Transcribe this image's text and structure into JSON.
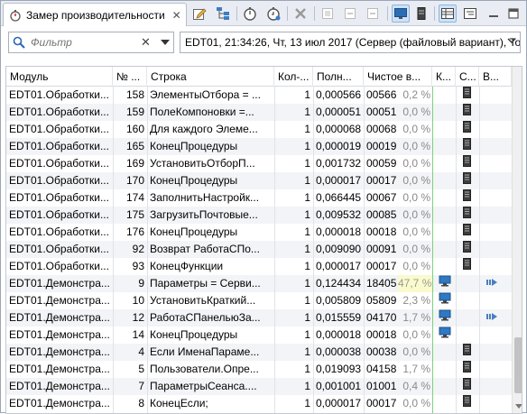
{
  "tab": {
    "title": "Замер производительности",
    "close": "✕"
  },
  "filter": {
    "placeholder": "Фильтр",
    "clear": "✕"
  },
  "session": {
    "text": "EDT01, 21:34:26, Чт, 13 июл 2017 (Сервер (файловый вариант), To"
  },
  "columns": [
    "Модуль",
    "№ ...",
    "Строка",
    "Кол-...",
    "Полн...",
    "Чистое в...",
    "К...",
    "С...",
    "В..."
  ],
  "rows": [
    {
      "module": "EDT01.Обработки...",
      "num": "158",
      "line": "ЭлементыОтбора = ...",
      "count": "1",
      "full": "0,000566",
      "net": "00566",
      "pct": "0,2 %",
      "client": false,
      "server": true,
      "call": false,
      "hl": false
    },
    {
      "module": "EDT01.Обработки...",
      "num": "159",
      "line": "ПолеКомпоновки =...",
      "count": "1",
      "full": "0,000051",
      "net": "00051",
      "pct": "0,0 %",
      "client": false,
      "server": true,
      "call": false,
      "hl": false
    },
    {
      "module": "EDT01.Обработки...",
      "num": "160",
      "line": "Для каждого Элеме...",
      "count": "1",
      "full": "0,000068",
      "net": "00068",
      "pct": "0,0 %",
      "client": false,
      "server": true,
      "call": false,
      "hl": false
    },
    {
      "module": "EDT01.Обработки...",
      "num": "165",
      "line": "КонецПроцедуры",
      "count": "1",
      "full": "0,000019",
      "net": "00019",
      "pct": "0,0 %",
      "client": false,
      "server": true,
      "call": false,
      "hl": false
    },
    {
      "module": "EDT01.Обработки...",
      "num": "169",
      "line": "УстановитьОтборП...",
      "count": "1",
      "full": "0,001732",
      "net": "00059",
      "pct": "0,0 %",
      "client": false,
      "server": true,
      "call": false,
      "hl": false
    },
    {
      "module": "EDT01.Обработки...",
      "num": "170",
      "line": "КонецПроцедуры",
      "count": "1",
      "full": "0,000017",
      "net": "00017",
      "pct": "0,0 %",
      "client": false,
      "server": true,
      "call": false,
      "hl": false
    },
    {
      "module": "EDT01.Обработки...",
      "num": "174",
      "line": "ЗаполнитьНастройк...",
      "count": "1",
      "full": "0,066445",
      "net": "00067",
      "pct": "0,0 %",
      "client": false,
      "server": true,
      "call": false,
      "hl": false
    },
    {
      "module": "EDT01.Обработки...",
      "num": "175",
      "line": "ЗагрузитьПочтовые...",
      "count": "1",
      "full": "0,009532",
      "net": "00085",
      "pct": "0,0 %",
      "client": false,
      "server": true,
      "call": false,
      "hl": false
    },
    {
      "module": "EDT01.Обработки...",
      "num": "176",
      "line": "КонецПроцедуры",
      "count": "1",
      "full": "0,000018",
      "net": "00018",
      "pct": "0,0 %",
      "client": false,
      "server": true,
      "call": false,
      "hl": false
    },
    {
      "module": "EDT01.Обработки...",
      "num": "92",
      "line": "Возврат РаботаСПо...",
      "count": "1",
      "full": "0,009090",
      "net": "00091",
      "pct": "0,0 %",
      "client": false,
      "server": true,
      "call": false,
      "hl": false
    },
    {
      "module": "EDT01.Обработки...",
      "num": "93",
      "line": "КонецФункции",
      "count": "1",
      "full": "0,000017",
      "net": "00017",
      "pct": "0,0 %",
      "client": false,
      "server": true,
      "call": false,
      "hl": false
    },
    {
      "module": "EDT01.Демонстра...",
      "num": "9",
      "line": "Параметры = Серви...",
      "count": "1",
      "full": "0,124434",
      "net": "18405",
      "pct": "47,7 %",
      "client": true,
      "server": false,
      "call": true,
      "hl": true
    },
    {
      "module": "EDT01.Демонстра...",
      "num": "10",
      "line": "УстановитьКраткий...",
      "count": "1",
      "full": "0,005809",
      "net": "05809",
      "pct": "2,3 %",
      "client": true,
      "server": false,
      "call": false,
      "hl": false
    },
    {
      "module": "EDT01.Демонстра...",
      "num": "12",
      "line": "РаботаСПанельюЗа...",
      "count": "1",
      "full": "0,015559",
      "net": "04170",
      "pct": "1,7 %",
      "client": true,
      "server": false,
      "call": true,
      "hl": false
    },
    {
      "module": "EDT01.Демонстра...",
      "num": "14",
      "line": "КонецПроцедуры",
      "count": "1",
      "full": "0,000018",
      "net": "00018",
      "pct": "0,0 %",
      "client": true,
      "server": false,
      "call": false,
      "hl": false
    },
    {
      "module": "EDT01.Демонстра...",
      "num": "4",
      "line": "Если ИменаПараме...",
      "count": "1",
      "full": "0,000038",
      "net": "00038",
      "pct": "0,0 %",
      "client": false,
      "server": true,
      "call": false,
      "hl": false
    },
    {
      "module": "EDT01.Демонстра...",
      "num": "5",
      "line": "Пользователи.Опре...",
      "count": "1",
      "full": "0,019093",
      "net": "04158",
      "pct": "1,7 %",
      "client": false,
      "server": true,
      "call": false,
      "hl": false
    },
    {
      "module": "EDT01.Демонстра...",
      "num": "7",
      "line": "ПараметрыСеанса....",
      "count": "1",
      "full": "0,001001",
      "net": "01001",
      "pct": "0,4 %",
      "client": false,
      "server": true,
      "call": false,
      "hl": false
    },
    {
      "module": "EDT01.Демонстра...",
      "num": "8",
      "line": "КонецЕсли;",
      "count": "1",
      "full": "0,000017",
      "net": "00017",
      "pct": "0,0 %",
      "client": false,
      "server": true,
      "call": false,
      "hl": false
    }
  ]
}
